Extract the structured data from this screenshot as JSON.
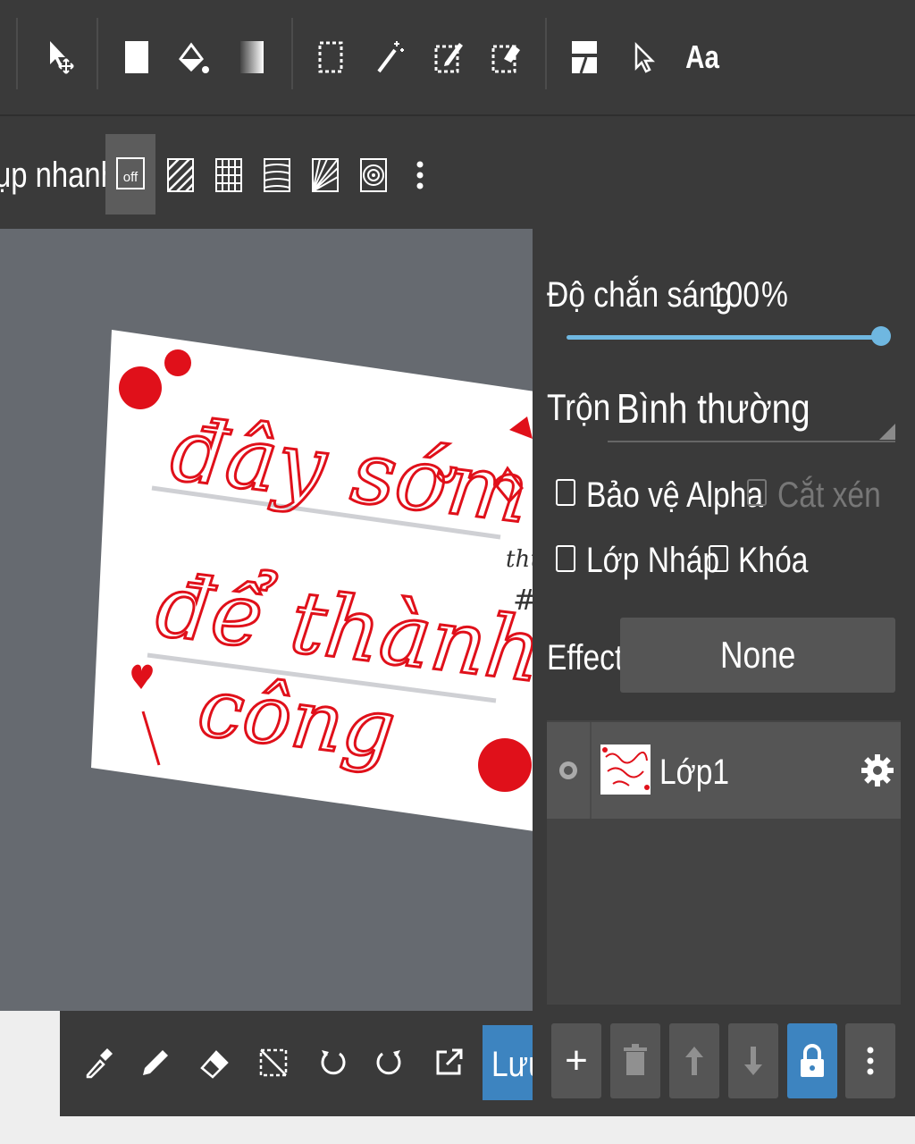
{
  "toolbar": {
    "tools": [
      {
        "name": "move-tool",
        "icon": "move-cursor-icon"
      },
      {
        "name": "fill-rect-tool",
        "icon": "rectangle-icon"
      },
      {
        "name": "bucket-tool",
        "icon": "bucket-icon"
      },
      {
        "name": "gradient-tool",
        "icon": "gradient-icon"
      },
      {
        "name": "select-tool",
        "icon": "dashed-select-icon"
      },
      {
        "name": "magic-wand-tool",
        "icon": "magic-wand-icon"
      },
      {
        "name": "select-pen-tool",
        "icon": "select-pen-icon"
      },
      {
        "name": "select-eraser-tool",
        "icon": "select-eraser-icon"
      },
      {
        "name": "frame-divider-tool",
        "icon": "frame-icon"
      },
      {
        "name": "operation-tool",
        "icon": "pointer-icon"
      },
      {
        "name": "text-tool",
        "icon": "text-icon"
      }
    ],
    "text_tool_label": "Aa"
  },
  "snap": {
    "label": "ụp nhanh",
    "off_label": "off",
    "options": [
      "snap-off-icon",
      "parallel-lines-icon",
      "grid-icon",
      "curve-lines-icon",
      "radial-icon",
      "circle-icon",
      "more-icon"
    ]
  },
  "canvas": {
    "artwork_text": [
      "đây sớm",
      "để thành",
      "công"
    ],
    "side_text": [
      "thu",
      "#"
    ]
  },
  "layer_panel": {
    "opacity_label": "Độ chắn sáng",
    "opacity_value": "100",
    "opacity_unit": "%",
    "opacity_fraction": 1.0,
    "blend_label": "Trộn",
    "blend_value": "Bình thường",
    "checkboxes": {
      "protect_alpha": "Bảo vệ Alpha",
      "clipping": "Cắt xén",
      "draft": "Lớp Nháp",
      "lock": "Khóa"
    },
    "effect_label": "Effect",
    "effect_value": "None",
    "layers": [
      {
        "name": "Lớp1",
        "visible": true
      }
    ]
  },
  "bottom_toolbar": {
    "tools": [
      "eyedropper-icon",
      "pen-icon",
      "eraser-icon",
      "deselect-icon",
      "undo-icon",
      "redo-icon",
      "export-icon"
    ],
    "save_label": "Lưu"
  },
  "layer_actions": {
    "add": "+",
    "buttons": [
      "add-layer-icon",
      "delete-icon",
      "move-up-icon",
      "move-down-icon",
      "lock-icon",
      "more-icon"
    ]
  },
  "colors": {
    "bar_bg": "#3a3a3a",
    "canvas_bg": "#666a70",
    "accent_blue": "#3d84c0",
    "slider_blue": "#6fb7e0",
    "ink_red": "#e0101a"
  }
}
